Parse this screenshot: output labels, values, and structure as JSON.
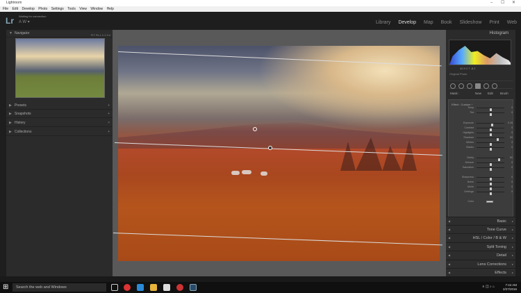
{
  "titlebar": {
    "title": "Lightroom"
  },
  "menu": [
    "File",
    "Edit",
    "Develop",
    "Photo",
    "Settings",
    "Tools",
    "View",
    "Window",
    "Help"
  ],
  "header": {
    "logo": "Lr",
    "status": "Waiting for connection",
    "user": "A W ▾"
  },
  "modules": [
    "Library",
    "Develop",
    "Map",
    "Book",
    "Slideshow",
    "Print",
    "Web"
  ],
  "active_module": "Develop",
  "left": {
    "navigator": "Navigator",
    "zoom": "FIT  FILL  1:1  3:4",
    "panels": [
      "Presets",
      "Snapshots",
      "History",
      "Collections"
    ]
  },
  "right": {
    "histogram": "Histogram",
    "histo_vals": "42.9   2.7   -8.2",
    "original_photo": "Original Photo",
    "mask_labels": [
      "Mask :",
      "New",
      "Edit",
      "Brush"
    ],
    "effect_head": "Effect :  Custom ÷",
    "sliders": [
      {
        "label": "Temp",
        "value": "0"
      },
      {
        "label": "Tint",
        "value": "0"
      },
      {
        "label": "Exposure",
        "value": "0.26"
      },
      {
        "label": "Contrast",
        "value": "0"
      },
      {
        "label": "Highlights",
        "value": "0"
      },
      {
        "label": "Shadows",
        "value": "50"
      },
      {
        "label": "Whites",
        "value": "0"
      },
      {
        "label": "Blacks",
        "value": "0"
      },
      {
        "label": "Clarity",
        "value": "80"
      },
      {
        "label": "Dehaze",
        "value": "0"
      },
      {
        "label": "Saturation",
        "value": "0"
      },
      {
        "label": "Sharpness",
        "value": "0"
      },
      {
        "label": "Noise",
        "value": "0"
      },
      {
        "label": "Moiré",
        "value": "0"
      },
      {
        "label": "Defringe",
        "value": "0"
      },
      {
        "label": "Color",
        "value": ""
      }
    ],
    "reset": "Reset",
    "close": "Close",
    "sections": [
      "Basic",
      "Tone Curve",
      "HSL  /  Color  /  B & W",
      "Split Toning",
      "Detail",
      "Lens Corrections",
      "Effects"
    ]
  },
  "taskbar": {
    "search": "Search the web and Windows",
    "time": "7:44 AM",
    "date": "2/27/2016"
  }
}
